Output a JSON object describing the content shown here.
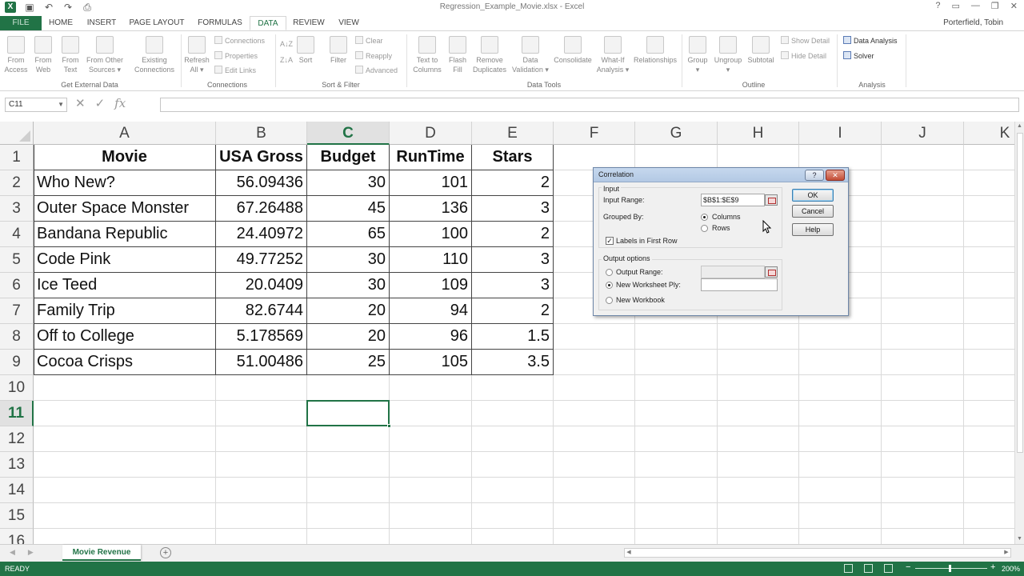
{
  "window": {
    "title": "Regression_Example_Movie.xlsx - Excel",
    "user": "Porterfield, Tobin",
    "controls": [
      "?",
      "▭",
      "—",
      "❐",
      "✕"
    ]
  },
  "quick_access": [
    "excel-logo",
    "save-icon",
    "undo-icon",
    "redo-icon",
    "print-preview-icon"
  ],
  "ribbon_tabs": {
    "file": "FILE",
    "home": "HOME",
    "insert": "INSERT",
    "page_layout": "PAGE LAYOUT",
    "formulas": "FORMULAS",
    "data": "DATA",
    "review": "REVIEW",
    "view": "VIEW",
    "active": "DATA"
  },
  "ribbon": {
    "get_external": {
      "from_access_1": "From",
      "from_access_2": "Access",
      "from_web_1": "From",
      "from_web_2": "Web",
      "from_text_1": "From",
      "from_text_2": "Text",
      "from_other_1": "From Other",
      "from_other_2": "Sources ▾",
      "existing_1": "Existing",
      "existing_2": "Connections",
      "group": "Get External Data"
    },
    "connections": {
      "refresh_1": "Refresh",
      "refresh_2": "All ▾",
      "connections": "Connections",
      "properties": "Properties",
      "edit_links": "Edit Links",
      "group": "Connections"
    },
    "sort_filter": {
      "sort": "Sort",
      "filter": "Filter",
      "clear": "Clear",
      "reapply": "Reapply",
      "advanced": "Advanced",
      "group": "Sort & Filter"
    },
    "data_tools": {
      "text_to_columns_1": "Text to",
      "text_to_columns_2": "Columns",
      "flash_fill_1": "Flash",
      "flash_fill_2": "Fill",
      "remove_dup_1": "Remove",
      "remove_dup_2": "Duplicates",
      "validation_1": "Data",
      "validation_2": "Validation ▾",
      "consolidate": "Consolidate",
      "whatif_1": "What-If",
      "whatif_2": "Analysis ▾",
      "relationships": "Relationships",
      "group": "Data Tools"
    },
    "outline": {
      "group_btn": "Group",
      "group_dd": "▾",
      "ungroup": "Ungroup",
      "ungroup_dd": "▾",
      "subtotal": "Subtotal",
      "show_detail": "Show Detail",
      "hide_detail": "Hide Detail",
      "group": "Outline"
    },
    "analysis": {
      "data_analysis": "Data Analysis",
      "solver": "Solver",
      "group": "Analysis"
    }
  },
  "formula_bar": {
    "name_box": "C11",
    "formula": "",
    "icons": [
      "cancel-icon",
      "enter-icon",
      "fx-icon"
    ]
  },
  "columns": [
    "A",
    "B",
    "C",
    "D",
    "E",
    "F",
    "G",
    "H",
    "I",
    "J",
    "K"
  ],
  "selected_column": "C",
  "rows": [
    "1",
    "2",
    "3",
    "4",
    "5",
    "6",
    "7",
    "8",
    "9",
    "10",
    "11",
    "12",
    "13",
    "14",
    "15",
    "16"
  ],
  "selected_row": "11",
  "table": {
    "headers": [
      "Movie",
      "USA Gross",
      "Budget",
      "RunTime",
      "Stars"
    ],
    "rows": [
      [
        "Who New?",
        "56.09436",
        "30",
        "101",
        "2"
      ],
      [
        "Outer Space Monster",
        "67.26488",
        "45",
        "136",
        "3"
      ],
      [
        "Bandana Republic",
        "24.40972",
        "65",
        "100",
        "2"
      ],
      [
        "Code Pink",
        "49.77252",
        "30",
        "110",
        "3"
      ],
      [
        "Ice Teed",
        "20.0409",
        "30",
        "109",
        "3"
      ],
      [
        "Family Trip",
        "82.6744",
        "20",
        "94",
        "2"
      ],
      [
        "Off to College",
        "5.178569",
        "20",
        "96",
        "1.5"
      ],
      [
        "Cocoa Crisps",
        "51.00486",
        "25",
        "105",
        "3.5"
      ]
    ]
  },
  "sheet_tabs": {
    "active": "Movie Revenue",
    "add": "+"
  },
  "status_bar": {
    "status": "READY",
    "zoom": "200%",
    "zoom_minus": "−",
    "zoom_plus": "+"
  },
  "dialog": {
    "title": "Correlation",
    "help_btn": "?",
    "close_btn": "✕",
    "input_section": "Input",
    "input_range_label": "Input Range:",
    "input_range_value": "$B$1:$E$9",
    "grouped_by_label": "Grouped By:",
    "columns_option": "Columns",
    "rows_option": "Rows",
    "grouped_by_selected": "Columns",
    "labels_first_row": "Labels in First Row",
    "labels_checked": "✓",
    "output_section": "Output options",
    "output_range": "Output Range:",
    "new_worksheet": "New Worksheet Ply:",
    "new_workbook": "New Workbook",
    "output_selected": "New Worksheet Ply:",
    "ok": "OK",
    "cancel": "Cancel",
    "help": "Help"
  },
  "colors": {
    "excel_green": "#217346",
    "dialog_title": "#c6d8ee"
  }
}
